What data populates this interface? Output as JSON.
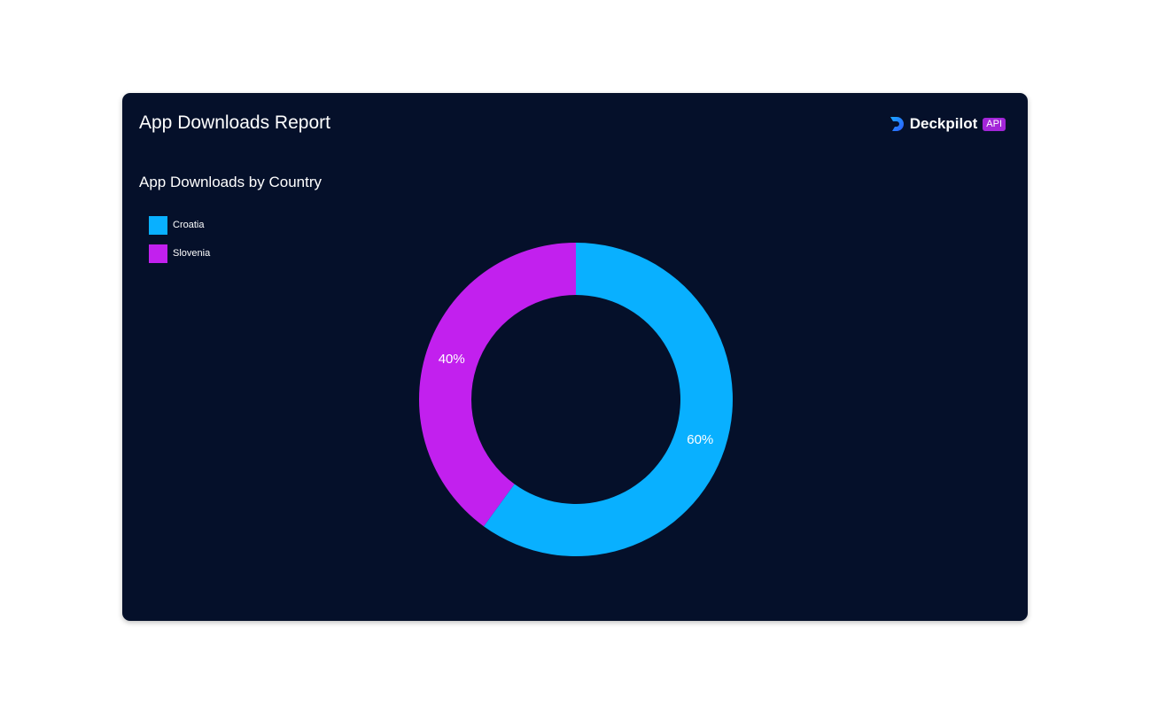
{
  "report": {
    "title": "App Downloads Report"
  },
  "brand": {
    "name": "Deckpilot",
    "badge": "API",
    "icon": "deckpilot-logo-icon",
    "colors": {
      "icon_start": "#1aa8ff",
      "icon_end": "#2f5bff",
      "badge": "#a326d8"
    }
  },
  "colors": {
    "background": "#05102a",
    "page": "#ffffff",
    "text": "#ffffff"
  },
  "chart_data": {
    "type": "pie",
    "variant": "donut",
    "title": "App Downloads by Country",
    "legend_position": "top-left",
    "slices": [
      {
        "label": "Croatia",
        "value": 60,
        "display": "60%",
        "color": "#09b0ff"
      },
      {
        "label": "Slovenia",
        "value": 40,
        "display": "40%",
        "color": "#c220ee"
      }
    ]
  }
}
